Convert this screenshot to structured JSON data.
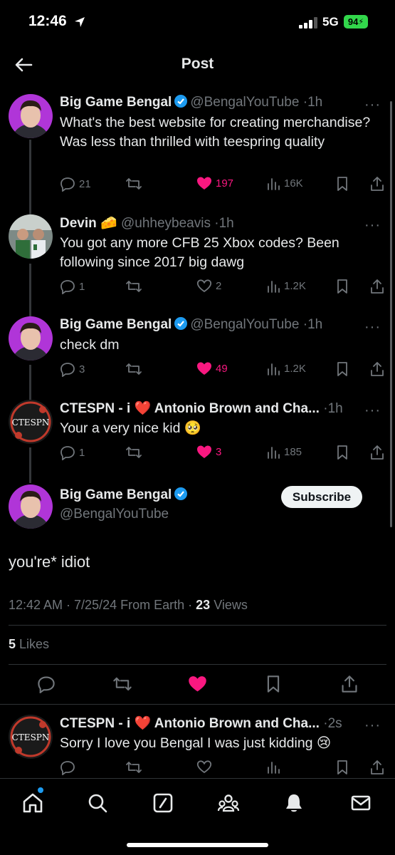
{
  "status": {
    "time": "12:46",
    "network": "5G",
    "battery": "94"
  },
  "header": {
    "title": "Post"
  },
  "tweets": [
    {
      "name": "Big Game Bengal",
      "handle": "@BengalYouTube",
      "dot": "·",
      "time": "1h",
      "text": "What's the best website for creating merchandise? Was less than thrilled with teespring quality",
      "replies": "21",
      "likes": "197",
      "views": "16K",
      "liked": true,
      "verified": true
    },
    {
      "name": "Devin",
      "emoji": "🧀",
      "handle": "@uhheybeavis",
      "dot": "·",
      "time": "1h",
      "text": "You got any more CFB 25 Xbox codes? Been following since 2017 big dawg",
      "replies": "1",
      "likes": "2",
      "views": "1.2K",
      "liked": false,
      "verified": false
    },
    {
      "name": "Big Game Bengal",
      "handle": "@BengalYouTube",
      "dot": "·",
      "time": "1h",
      "text": "check dm",
      "replies": "3",
      "likes": "49",
      "views": "1.2K",
      "liked": true,
      "verified": true
    },
    {
      "name": "CTESPN - i ❤️ Antonio Brown and Cha...",
      "handle": "",
      "dot": "·",
      "time": "1h",
      "text": "Your a very nice kid 🥺",
      "replies": "1",
      "likes": "3",
      "views": "185",
      "liked": true,
      "verified": false
    }
  ],
  "main": {
    "name": "Big Game Bengal",
    "handle": "@BengalYouTube",
    "subscribe": "Subscribe",
    "text": "you're* idiot",
    "timestamp": "12:42 AM · 7/25/24 From Earth ·",
    "views_count": "23",
    "views_label": "Views",
    "likes_count": "5",
    "likes_label": "Likes"
  },
  "reply": {
    "name": "CTESPN - i ❤️ Antonio Brown and Cha...",
    "dot": "·",
    "time": "2s",
    "text": "Sorry I love you Bengal I was just kidding 😢"
  },
  "colors": {
    "like": "#f91880",
    "verified": "#1d9bf0",
    "muted": "#71767b"
  },
  "icons": [
    "back-arrow-icon",
    "reply-icon",
    "retweet-icon",
    "heart-icon",
    "views-icon",
    "bookmark-icon",
    "share-icon",
    "home-icon",
    "search-icon",
    "grok-icon",
    "communities-icon",
    "notifications-icon",
    "messages-icon"
  ]
}
